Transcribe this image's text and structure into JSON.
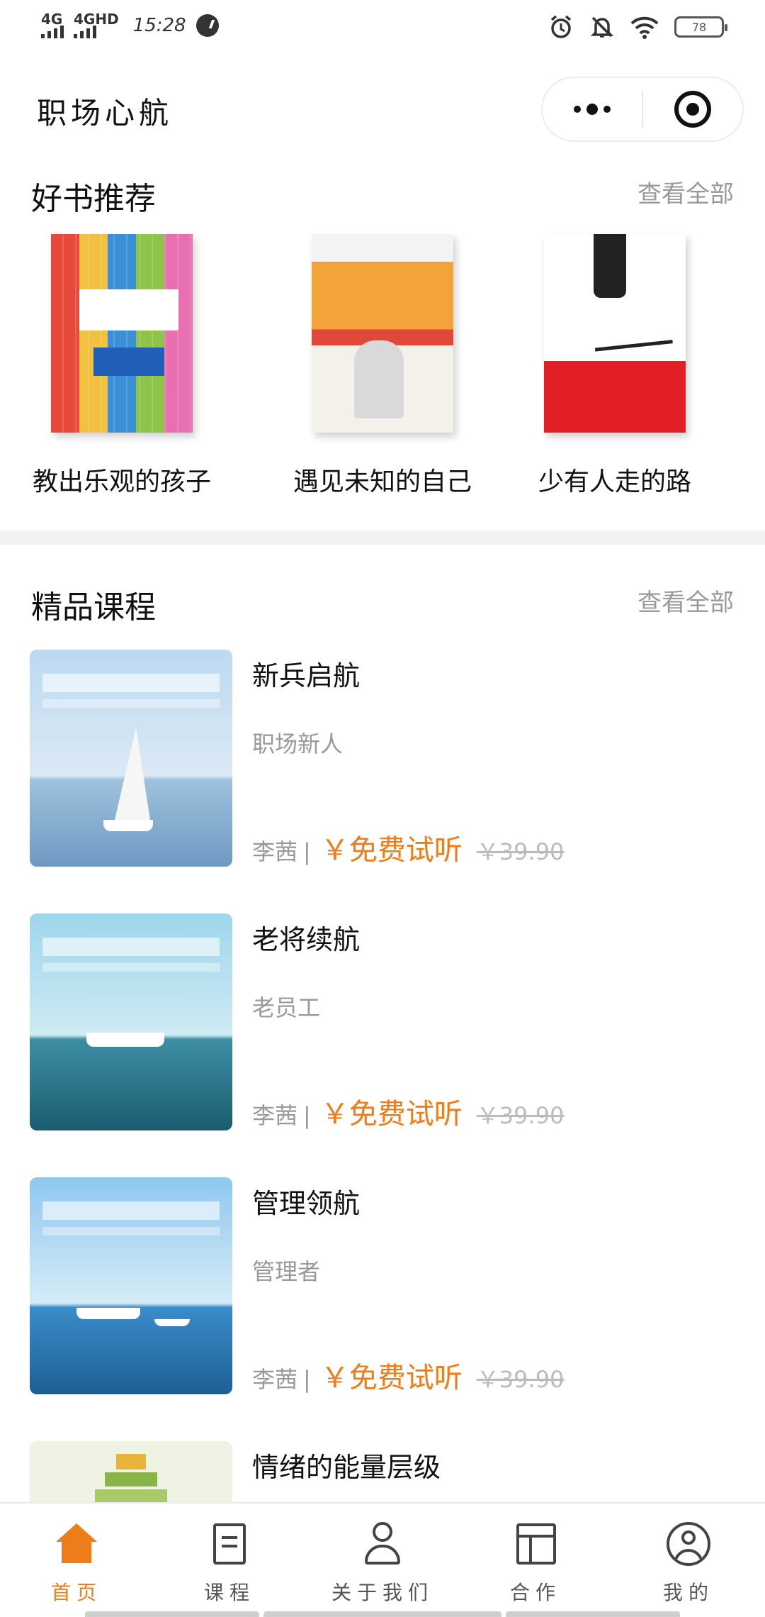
{
  "status_bar": {
    "signal1_label": "4G",
    "signal2_label": "4GHD",
    "time": "15:28",
    "battery": "78"
  },
  "nav": {
    "title": "职场心航"
  },
  "books_section": {
    "title": "好书推荐",
    "more": "查看全部",
    "items": [
      {
        "title": "教出乐观的孩子"
      },
      {
        "title": "遇见未知的自己"
      },
      {
        "title": "少有人走的路"
      }
    ]
  },
  "courses_section": {
    "title": "精品课程",
    "more": "查看全部",
    "items": [
      {
        "title": "新兵启航",
        "subtitle": "职场新人",
        "author": "李茜",
        "separator": "|",
        "free_label": "￥免费试听",
        "original_price": "￥39.90"
      },
      {
        "title": "老将续航",
        "subtitle": "老员工",
        "author": "李茜",
        "separator": "|",
        "free_label": "￥免费试听",
        "original_price": "￥39.90"
      },
      {
        "title": "管理领航",
        "subtitle": "管理者",
        "author": "李茜",
        "separator": "|",
        "free_label": "￥免费试听",
        "original_price": "￥39.90"
      },
      {
        "title": "情绪的能量层级"
      }
    ]
  },
  "tabbar": {
    "items": [
      {
        "label": "首页",
        "icon": "home-icon",
        "active": true
      },
      {
        "label": "课程",
        "icon": "document-icon"
      },
      {
        "label": "关于我们",
        "icon": "user-icon"
      },
      {
        "label": "合作",
        "icon": "layout-icon"
      },
      {
        "label": "我的",
        "icon": "profile-icon"
      }
    ]
  },
  "colors": {
    "accent": "#ef7c1a",
    "muted_text": "#999999",
    "divider": "#f2f2f2"
  }
}
